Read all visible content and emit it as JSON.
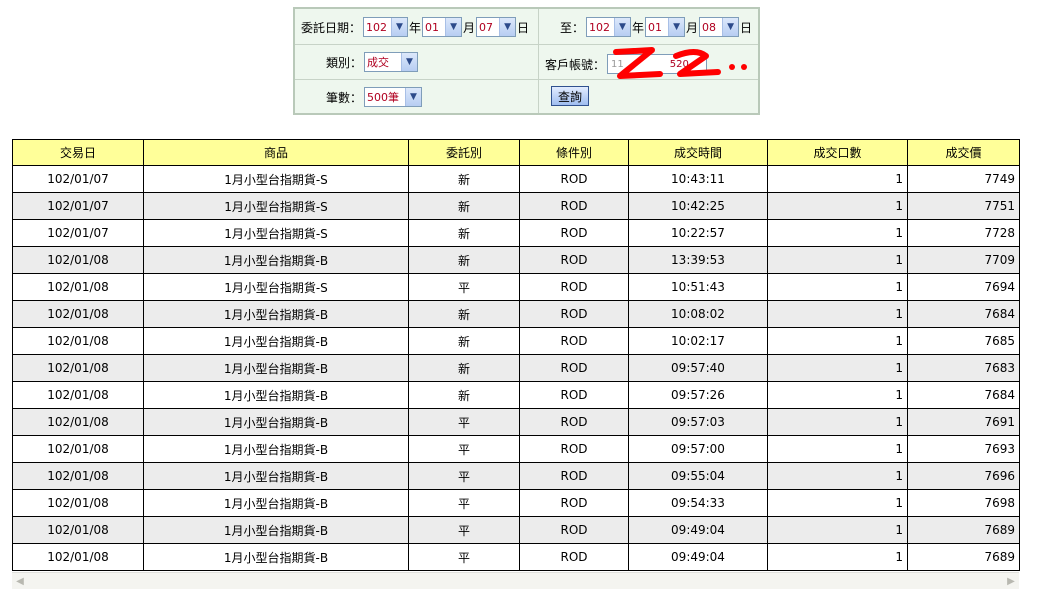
{
  "form": {
    "order_date_label": "委託日期：",
    "to_label": "至：",
    "year_unit": "年",
    "month_unit": "月",
    "day_unit": "日",
    "from_year": "102",
    "from_month": "01",
    "from_day": "07",
    "to_year": "102",
    "to_month": "01",
    "to_day": "08",
    "category_label": "類別：",
    "category_value": "成交",
    "account_label": "客戶帳號：",
    "account_value": "11",
    "account_value_tail": "520",
    "count_label": "筆數：",
    "count_value": "500筆",
    "query_button": "查詢",
    "scribble_color": "#ff0000"
  },
  "table": {
    "headers": [
      "交易日",
      "商品",
      "委託別",
      "條件別",
      "成交時間",
      "成交口數",
      "成交價"
    ],
    "rows": [
      [
        "102/01/07",
        "1月小型台指期貨-S",
        "新",
        "ROD",
        "10:43:11",
        "1",
        "7749"
      ],
      [
        "102/01/07",
        "1月小型台指期貨-S",
        "新",
        "ROD",
        "10:42:25",
        "1",
        "7751"
      ],
      [
        "102/01/07",
        "1月小型台指期貨-S",
        "新",
        "ROD",
        "10:22:57",
        "1",
        "7728"
      ],
      [
        "102/01/08",
        "1月小型台指期貨-B",
        "新",
        "ROD",
        "13:39:53",
        "1",
        "7709"
      ],
      [
        "102/01/08",
        "1月小型台指期貨-S",
        "平",
        "ROD",
        "10:51:43",
        "1",
        "7694"
      ],
      [
        "102/01/08",
        "1月小型台指期貨-B",
        "新",
        "ROD",
        "10:08:02",
        "1",
        "7684"
      ],
      [
        "102/01/08",
        "1月小型台指期貨-B",
        "新",
        "ROD",
        "10:02:17",
        "1",
        "7685"
      ],
      [
        "102/01/08",
        "1月小型台指期貨-B",
        "新",
        "ROD",
        "09:57:40",
        "1",
        "7683"
      ],
      [
        "102/01/08",
        "1月小型台指期貨-B",
        "新",
        "ROD",
        "09:57:26",
        "1",
        "7684"
      ],
      [
        "102/01/08",
        "1月小型台指期貨-B",
        "平",
        "ROD",
        "09:57:03",
        "1",
        "7691"
      ],
      [
        "102/01/08",
        "1月小型台指期貨-B",
        "平",
        "ROD",
        "09:57:00",
        "1",
        "7693"
      ],
      [
        "102/01/08",
        "1月小型台指期貨-B",
        "平",
        "ROD",
        "09:55:04",
        "1",
        "7696"
      ],
      [
        "102/01/08",
        "1月小型台指期貨-B",
        "平",
        "ROD",
        "09:54:33",
        "1",
        "7698"
      ],
      [
        "102/01/08",
        "1月小型台指期貨-B",
        "平",
        "ROD",
        "09:49:04",
        "1",
        "7689"
      ],
      [
        "102/01/08",
        "1月小型台指期貨-B",
        "平",
        "ROD",
        "09:49:04",
        "1",
        "7689"
      ]
    ],
    "header_bg": "#ffff99",
    "alt_row_bg": "#ececec"
  },
  "scrollbar": {
    "left_icon": "chevron-left-icon",
    "right_icon": "chevron-right-icon"
  }
}
